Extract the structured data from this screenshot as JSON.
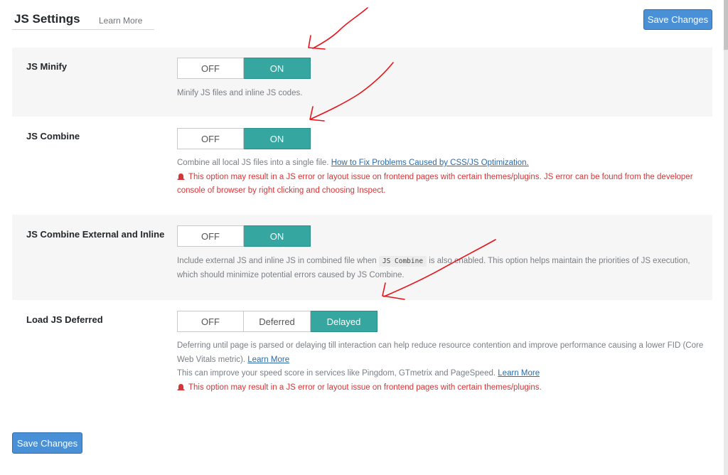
{
  "header": {
    "title": "JS Settings",
    "learn_more": "Learn More"
  },
  "save_top": "Save Changes",
  "save_bottom": "Save Changes",
  "rows": [
    {
      "label": "JS Minify",
      "options": [
        "OFF",
        "ON"
      ],
      "selected": "ON",
      "desc": "Minify JS files and inline JS codes."
    },
    {
      "label": "JS Combine",
      "options": [
        "OFF",
        "ON"
      ],
      "selected": "ON",
      "desc": "Combine all local JS files into a single file.",
      "link": "How to Fix Problems Caused by CSS/JS Optimization.",
      "warning": "This option may result in a JS error or layout issue on frontend pages with certain themes/plugins. JS error can be found from the developer console of browser by right clicking and choosing Inspect."
    },
    {
      "label": "JS Combine External and Inline",
      "options": [
        "OFF",
        "ON"
      ],
      "selected": "ON",
      "desc_before": "Include external JS and inline JS in combined file when",
      "code": "JS Combine",
      "desc_after": "is also enabled. This option helps maintain the priorities of JS execution, which should minimize potential errors caused by JS Combine."
    },
    {
      "label": "Load JS Deferred",
      "options": [
        "OFF",
        "Deferred",
        "Delayed"
      ],
      "selected": "Delayed",
      "desc": "Deferring until page is parsed or delaying till interaction can help reduce resource contention and improve performance causing a lower FID (Core Web Vitals metric).",
      "link": "Learn More",
      "desc2": "This can improve your speed score in services like Pingdom, GTmetrix and PageSpeed.",
      "link2": "Learn More",
      "warning": "This option may result in a JS error or layout issue on frontend pages with certain themes/plugins."
    }
  ],
  "colors": {
    "accent": "#36a6a0",
    "button": "#4a90d6",
    "warning": "#d63638",
    "annotation": "#e8141b"
  }
}
